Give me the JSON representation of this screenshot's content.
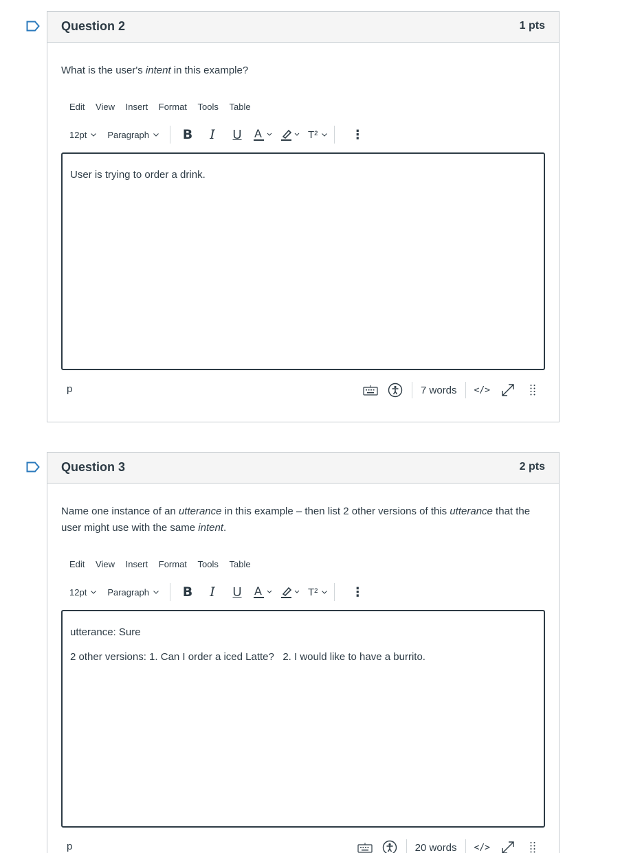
{
  "questions": [
    {
      "title": "Question 2",
      "points": "1 pts",
      "prompt": {
        "p1": "What is the user's ",
        "p2": "intent",
        "p3": " in this example?"
      },
      "menu": [
        "Edit",
        "View",
        "Insert",
        "Format",
        "Tools",
        "Table"
      ],
      "font_size": "12pt",
      "block_format": "Paragraph",
      "answer_lines": [
        "User is trying to order a drink."
      ],
      "path": "p",
      "word_count": "7 words",
      "code_label": "</>"
    },
    {
      "title": "Question 3",
      "points": "2 pts",
      "prompt": {
        "p1": "Name one instance of an ",
        "p2": "utterance",
        "p3": " in this example – then list 2 other versions of this ",
        "p4": "utterance",
        "p5": " that the user might use with the same ",
        "p6": "intent",
        "p7": "."
      },
      "menu": [
        "Edit",
        "View",
        "Insert",
        "Format",
        "Tools",
        "Table"
      ],
      "font_size": "12pt",
      "block_format": "Paragraph",
      "answer_lines": [
        "utterance: Sure",
        "2 other versions: 1. Can I order a iced Latte?   2. I would like to have a burrito."
      ],
      "path": "p",
      "word_count": "20 words",
      "code_label": "</>"
    }
  ],
  "toolbar": {
    "superscript_label": "T²",
    "more_label": "⋮"
  },
  "icons": {
    "flag": "flag-outline-icon",
    "keyboard": "keyboard-icon",
    "accessibility": "accessibility-icon",
    "fullscreen": "expand-icon",
    "resize": "drag-handle-icon"
  },
  "colors": {
    "accent": "#2b7abc",
    "text": "#2d3b45",
    "header_bg": "#f5f5f5",
    "border": "#c7cdd1"
  }
}
